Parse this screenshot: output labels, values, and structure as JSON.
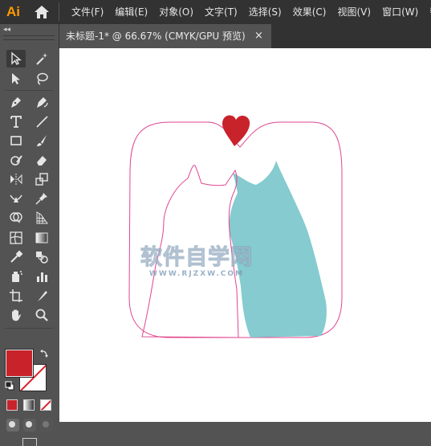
{
  "app": {
    "logo": "Ai",
    "home_icon": "home-icon"
  },
  "menu": {
    "items": [
      {
        "label": "文件(F)"
      },
      {
        "label": "编辑(E)"
      },
      {
        "label": "对象(O)"
      },
      {
        "label": "文字(T)"
      },
      {
        "label": "选择(S)"
      },
      {
        "label": "效果(C)"
      },
      {
        "label": "视图(V)"
      },
      {
        "label": "窗口(W)"
      },
      {
        "label": "帮"
      }
    ]
  },
  "toolbar": {
    "collapse_glyph": "◂◂",
    "tools": [
      {
        "name": "selection-tool-icon"
      },
      {
        "name": "magic-wand-tool-icon"
      },
      {
        "name": "direct-selection-tool-icon"
      },
      {
        "name": "lasso-tool-icon"
      },
      {
        "name": "pen-tool-icon"
      },
      {
        "name": "curvature-tool-icon"
      },
      {
        "name": "type-tool-icon"
      },
      {
        "name": "line-segment-tool-icon"
      },
      {
        "name": "rectangle-tool-icon"
      },
      {
        "name": "paintbrush-tool-icon"
      },
      {
        "name": "shaper-tool-icon"
      },
      {
        "name": "eraser-tool-icon"
      },
      {
        "name": "reflect-tool-icon"
      },
      {
        "name": "scale-tool-icon"
      },
      {
        "name": "width-tool-icon"
      },
      {
        "name": "puppet-warp-tool-icon"
      },
      {
        "name": "shape-builder-tool-icon"
      },
      {
        "name": "perspective-grid-tool-icon"
      },
      {
        "name": "mesh-tool-icon"
      },
      {
        "name": "gradient-tool-icon"
      },
      {
        "name": "eyedropper-tool-icon"
      },
      {
        "name": "blend-tool-icon"
      },
      {
        "name": "symbol-sprayer-tool-icon"
      },
      {
        "name": "column-graph-tool-icon"
      },
      {
        "name": "artboard-tool-icon"
      },
      {
        "name": "slice-tool-icon"
      },
      {
        "name": "hand-tool-icon"
      },
      {
        "name": "zoom-tool-icon"
      }
    ],
    "fill_color": "#c8232b",
    "stroke_color": "none"
  },
  "document": {
    "tab_title": "未标题-1* @ 66.67% (CMYK/GPU 预览)",
    "close_glyph": "×"
  },
  "artwork": {
    "outline_color": "#e0458f",
    "heart_color": "#c8232b",
    "right_cat_color": "#85cbcf"
  },
  "watermark": {
    "title": "软件自学网",
    "subtitle": "WWW.RJZXW.COM"
  }
}
